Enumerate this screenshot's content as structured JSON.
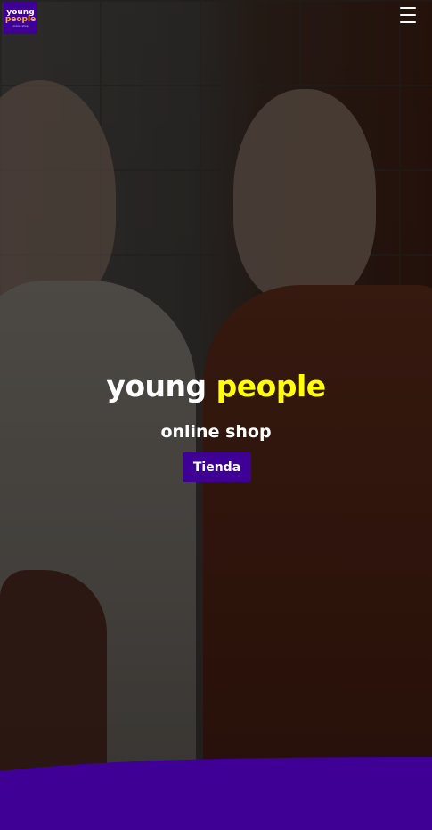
{
  "header": {
    "logo": {
      "line1": "young",
      "line2": "people",
      "tagline": "online shop"
    },
    "menu_icon": "hamburger-menu-icon"
  },
  "hero": {
    "title_part1": "young ",
    "title_part2": "people",
    "subtitle": "online shop",
    "button_label": "Tienda"
  },
  "colors": {
    "brand_purple": "#3e0095",
    "accent_yellow": "#ffff00",
    "logo_orange": "#ffb300",
    "text_white": "#ffffff"
  }
}
